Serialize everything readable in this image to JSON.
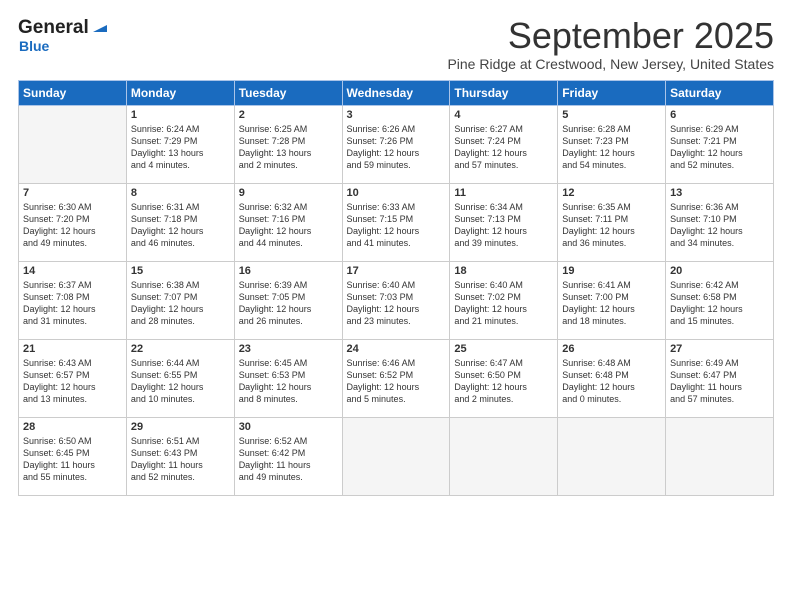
{
  "header": {
    "logo_general": "General",
    "logo_blue": "Blue",
    "month_title": "September 2025",
    "subtitle": "Pine Ridge at Crestwood, New Jersey, United States"
  },
  "weekdays": [
    "Sunday",
    "Monday",
    "Tuesday",
    "Wednesday",
    "Thursday",
    "Friday",
    "Saturday"
  ],
  "weeks": [
    [
      {
        "day": "",
        "empty": true
      },
      {
        "day": "1",
        "sunrise": "Sunrise: 6:24 AM",
        "sunset": "Sunset: 7:29 PM",
        "daylight": "Daylight: 13 hours and 4 minutes."
      },
      {
        "day": "2",
        "sunrise": "Sunrise: 6:25 AM",
        "sunset": "Sunset: 7:28 PM",
        "daylight": "Daylight: 13 hours and 2 minutes."
      },
      {
        "day": "3",
        "sunrise": "Sunrise: 6:26 AM",
        "sunset": "Sunset: 7:26 PM",
        "daylight": "Daylight: 12 hours and 59 minutes."
      },
      {
        "day": "4",
        "sunrise": "Sunrise: 6:27 AM",
        "sunset": "Sunset: 7:24 PM",
        "daylight": "Daylight: 12 hours and 57 minutes."
      },
      {
        "day": "5",
        "sunrise": "Sunrise: 6:28 AM",
        "sunset": "Sunset: 7:23 PM",
        "daylight": "Daylight: 12 hours and 54 minutes."
      },
      {
        "day": "6",
        "sunrise": "Sunrise: 6:29 AM",
        "sunset": "Sunset: 7:21 PM",
        "daylight": "Daylight: 12 hours and 52 minutes."
      }
    ],
    [
      {
        "day": "7",
        "sunrise": "Sunrise: 6:30 AM",
        "sunset": "Sunset: 7:20 PM",
        "daylight": "Daylight: 12 hours and 49 minutes."
      },
      {
        "day": "8",
        "sunrise": "Sunrise: 6:31 AM",
        "sunset": "Sunset: 7:18 PM",
        "daylight": "Daylight: 12 hours and 46 minutes."
      },
      {
        "day": "9",
        "sunrise": "Sunrise: 6:32 AM",
        "sunset": "Sunset: 7:16 PM",
        "daylight": "Daylight: 12 hours and 44 minutes."
      },
      {
        "day": "10",
        "sunrise": "Sunrise: 6:33 AM",
        "sunset": "Sunset: 7:15 PM",
        "daylight": "Daylight: 12 hours and 41 minutes."
      },
      {
        "day": "11",
        "sunrise": "Sunrise: 6:34 AM",
        "sunset": "Sunset: 7:13 PM",
        "daylight": "Daylight: 12 hours and 39 minutes."
      },
      {
        "day": "12",
        "sunrise": "Sunrise: 6:35 AM",
        "sunset": "Sunset: 7:11 PM",
        "daylight": "Daylight: 12 hours and 36 minutes."
      },
      {
        "day": "13",
        "sunrise": "Sunrise: 6:36 AM",
        "sunset": "Sunset: 7:10 PM",
        "daylight": "Daylight: 12 hours and 34 minutes."
      }
    ],
    [
      {
        "day": "14",
        "sunrise": "Sunrise: 6:37 AM",
        "sunset": "Sunset: 7:08 PM",
        "daylight": "Daylight: 12 hours and 31 minutes."
      },
      {
        "day": "15",
        "sunrise": "Sunrise: 6:38 AM",
        "sunset": "Sunset: 7:07 PM",
        "daylight": "Daylight: 12 hours and 28 minutes."
      },
      {
        "day": "16",
        "sunrise": "Sunrise: 6:39 AM",
        "sunset": "Sunset: 7:05 PM",
        "daylight": "Daylight: 12 hours and 26 minutes."
      },
      {
        "day": "17",
        "sunrise": "Sunrise: 6:40 AM",
        "sunset": "Sunset: 7:03 PM",
        "daylight": "Daylight: 12 hours and 23 minutes."
      },
      {
        "day": "18",
        "sunrise": "Sunrise: 6:40 AM",
        "sunset": "Sunset: 7:02 PM",
        "daylight": "Daylight: 12 hours and 21 minutes."
      },
      {
        "day": "19",
        "sunrise": "Sunrise: 6:41 AM",
        "sunset": "Sunset: 7:00 PM",
        "daylight": "Daylight: 12 hours and 18 minutes."
      },
      {
        "day": "20",
        "sunrise": "Sunrise: 6:42 AM",
        "sunset": "Sunset: 6:58 PM",
        "daylight": "Daylight: 12 hours and 15 minutes."
      }
    ],
    [
      {
        "day": "21",
        "sunrise": "Sunrise: 6:43 AM",
        "sunset": "Sunset: 6:57 PM",
        "daylight": "Daylight: 12 hours and 13 minutes."
      },
      {
        "day": "22",
        "sunrise": "Sunrise: 6:44 AM",
        "sunset": "Sunset: 6:55 PM",
        "daylight": "Daylight: 12 hours and 10 minutes."
      },
      {
        "day": "23",
        "sunrise": "Sunrise: 6:45 AM",
        "sunset": "Sunset: 6:53 PM",
        "daylight": "Daylight: 12 hours and 8 minutes."
      },
      {
        "day": "24",
        "sunrise": "Sunrise: 6:46 AM",
        "sunset": "Sunset: 6:52 PM",
        "daylight": "Daylight: 12 hours and 5 minutes."
      },
      {
        "day": "25",
        "sunrise": "Sunrise: 6:47 AM",
        "sunset": "Sunset: 6:50 PM",
        "daylight": "Daylight: 12 hours and 2 minutes."
      },
      {
        "day": "26",
        "sunrise": "Sunrise: 6:48 AM",
        "sunset": "Sunset: 6:48 PM",
        "daylight": "Daylight: 12 hours and 0 minutes."
      },
      {
        "day": "27",
        "sunrise": "Sunrise: 6:49 AM",
        "sunset": "Sunset: 6:47 PM",
        "daylight": "Daylight: 11 hours and 57 minutes."
      }
    ],
    [
      {
        "day": "28",
        "sunrise": "Sunrise: 6:50 AM",
        "sunset": "Sunset: 6:45 PM",
        "daylight": "Daylight: 11 hours and 55 minutes."
      },
      {
        "day": "29",
        "sunrise": "Sunrise: 6:51 AM",
        "sunset": "Sunset: 6:43 PM",
        "daylight": "Daylight: 11 hours and 52 minutes."
      },
      {
        "day": "30",
        "sunrise": "Sunrise: 6:52 AM",
        "sunset": "Sunset: 6:42 PM",
        "daylight": "Daylight: 11 hours and 49 minutes."
      },
      {
        "day": "",
        "empty": true
      },
      {
        "day": "",
        "empty": true
      },
      {
        "day": "",
        "empty": true
      },
      {
        "day": "",
        "empty": true
      }
    ]
  ]
}
